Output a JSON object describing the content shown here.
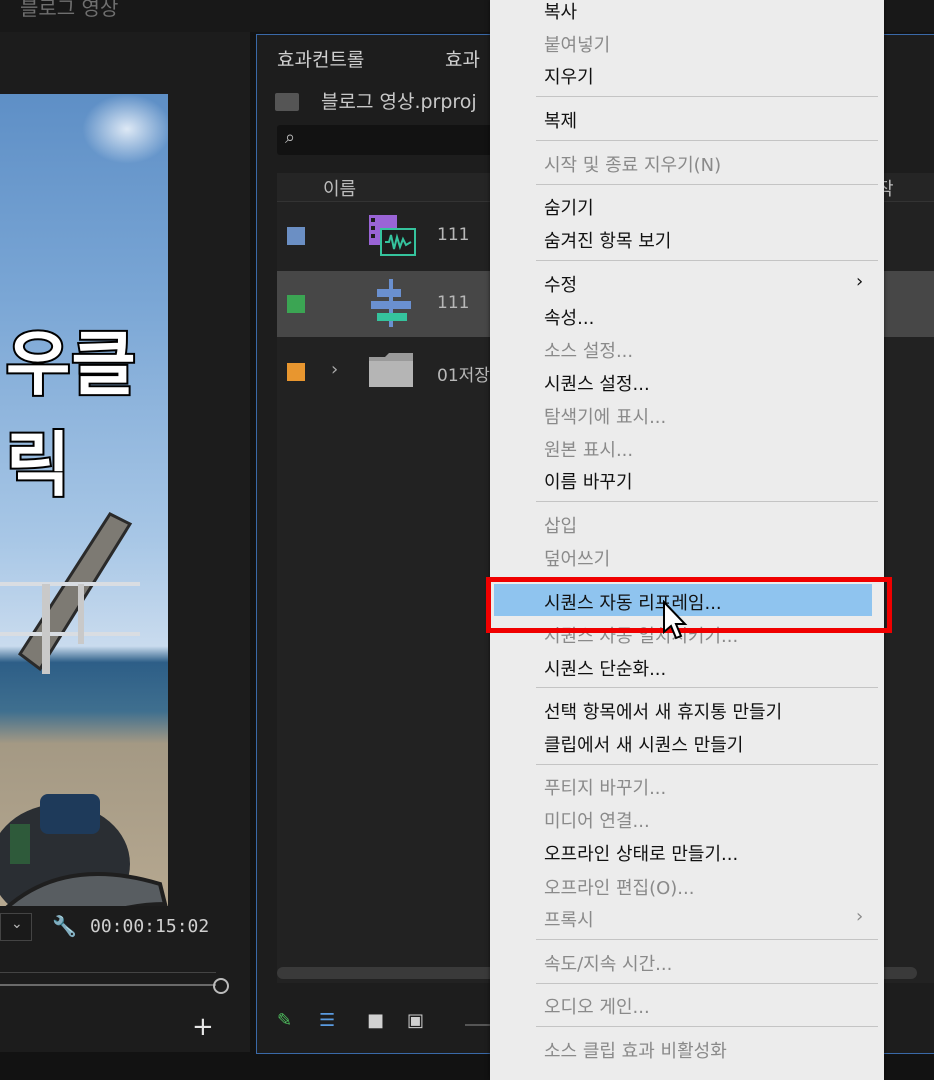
{
  "window_title": "블로그 영상",
  "monitor": {
    "overlay_text": "우클릭",
    "zoom_chevron": "⌄",
    "timecode": "00:00:15:02",
    "add_label": "+"
  },
  "project_panel": {
    "tabs": [
      "효과컨트롤",
      "효과"
    ],
    "project_name": "블로그 영상.prproj",
    "search_placeholder": "",
    "columns": {
      "name": "이름",
      "start": "작"
    },
    "items": [
      {
        "color": "#6b8fc4",
        "label": "111",
        "icon": "sequence-icon"
      },
      {
        "color": "#3ba553",
        "label": "111",
        "icon": "multicam-sequence-icon"
      },
      {
        "color": "#e8962f",
        "label": "01저장",
        "icon": "folder-icon"
      }
    ],
    "expand_chevron": "›"
  },
  "context_menu": {
    "items": [
      {
        "label": "복사",
        "enabled": true
      },
      {
        "label": "붙여넣기",
        "enabled": false
      },
      {
        "label": "지우기",
        "enabled": true
      },
      {
        "label": "복제",
        "enabled": true
      },
      {
        "label": "시작 및 종료 지우기(N)",
        "enabled": false
      },
      {
        "label": "숨기기",
        "enabled": true
      },
      {
        "label": "숨겨진 항목 보기",
        "enabled": true
      },
      {
        "label": "수정",
        "enabled": true,
        "submenu": true
      },
      {
        "label": "속성...",
        "enabled": true
      },
      {
        "label": "소스 설정...",
        "enabled": false
      },
      {
        "label": "시퀀스 설정...",
        "enabled": true
      },
      {
        "label": "탐색기에 표시...",
        "enabled": false
      },
      {
        "label": "원본 표시...",
        "enabled": false
      },
      {
        "label": "이름 바꾸기",
        "enabled": true
      },
      {
        "label": "삽입",
        "enabled": false
      },
      {
        "label": "덮어쓰기",
        "enabled": false
      },
      {
        "label": "시퀀스 자동 리프레임...",
        "enabled": true,
        "highlighted": true
      },
      {
        "label": "시퀀스 자동 일치시키기...",
        "enabled": false
      },
      {
        "label": "시퀀스 단순화...",
        "enabled": true
      },
      {
        "label": "선택 항목에서 새 휴지통 만들기",
        "enabled": true
      },
      {
        "label": "클립에서 새 시퀀스 만들기",
        "enabled": true
      },
      {
        "label": "푸티지 바꾸기...",
        "enabled": false
      },
      {
        "label": "미디어 연결...",
        "enabled": false
      },
      {
        "label": "오프라인 상태로 만들기...",
        "enabled": true
      },
      {
        "label": "오프라인 편집(O)...",
        "enabled": false
      },
      {
        "label": "프록시",
        "enabled": false,
        "submenu": true
      },
      {
        "label": "속도/지속 시간...",
        "enabled": false
      },
      {
        "label": "오디오 게인...",
        "enabled": false
      },
      {
        "label": "소스 클립 효과 비활성화",
        "enabled": false
      }
    ],
    "submenu_arrow": "›",
    "highlight_color": "#8fc4ef",
    "annotation_color": "#f00000"
  }
}
